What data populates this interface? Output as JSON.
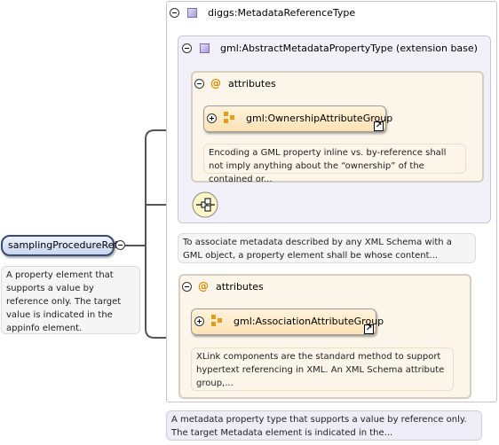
{
  "root_element": {
    "name": "samplingProcedureRef",
    "documentation": "A property element that supports a value by reference only. The target value is indicated in the appinfo element."
  },
  "type": {
    "name": "diggs:MetadataReferenceType",
    "documentation": "A metadata property type that supports a value by reference only. The target Metadata element is indicated in the..."
  },
  "extension": {
    "name": "gml:AbstractMetadataPropertyType (extension base)",
    "documentation": "To associate metadata described by any XML Schema with a GML object, a property element shall be whose content...",
    "attributes_label": "attributes",
    "group": {
      "name": "gml:OwnershipAttributeGroup",
      "documentation": "Encoding a GML property inline vs. by-reference shall not imply anything about the “ownership” of the contained or..."
    }
  },
  "attributes": {
    "label": "attributes",
    "group": {
      "name": "gml:AssociationAttributeGroup",
      "documentation": "XLink components are the standard method to support hypertext referencing in XML. An XML Schema attribute group,..."
    }
  },
  "colors": {
    "type_fill": "#f2f1f9",
    "attr_fill": "#fcf6ea",
    "group_fill": "#fde2b5",
    "root_fill": "#d7e3f7",
    "connector": "#555555"
  }
}
